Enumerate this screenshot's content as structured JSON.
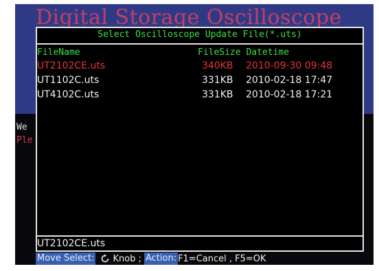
{
  "background": {
    "title": "Digital Storage Oscilloscope",
    "line1": "We",
    "line2": "Ple"
  },
  "dialog": {
    "title": "Select Oscilloscope Update File(*.uts)",
    "header": {
      "filename": "FileName",
      "size_datetime": "FileSize Datetime"
    },
    "files": [
      {
        "name": "UT2102CE.uts",
        "size": "340KB",
        "datetime": "2010-09-30 09:48",
        "selected": true
      },
      {
        "name": "UT1102C.uts",
        "size": "331KB",
        "datetime": "2010-02-18 17:47",
        "selected": false
      },
      {
        "name": "UT4102C.uts",
        "size": "331KB",
        "datetime": "2010-02-18 17:21",
        "selected": false
      }
    ],
    "current_file": "UT2102CE.uts"
  },
  "hint": {
    "move_select": "Move Select:",
    "knob": "Knob ;",
    "action": "Action:",
    "keys": "F1=Cancel , F5=OK"
  },
  "colors": {
    "header_green": "#3ee04a",
    "selected_red": "#e8323c",
    "highlight_blue": "#3b5fb0",
    "band_blue": "#2f3a86"
  },
  "icons": {
    "knob": "rotate-knob-icon"
  }
}
